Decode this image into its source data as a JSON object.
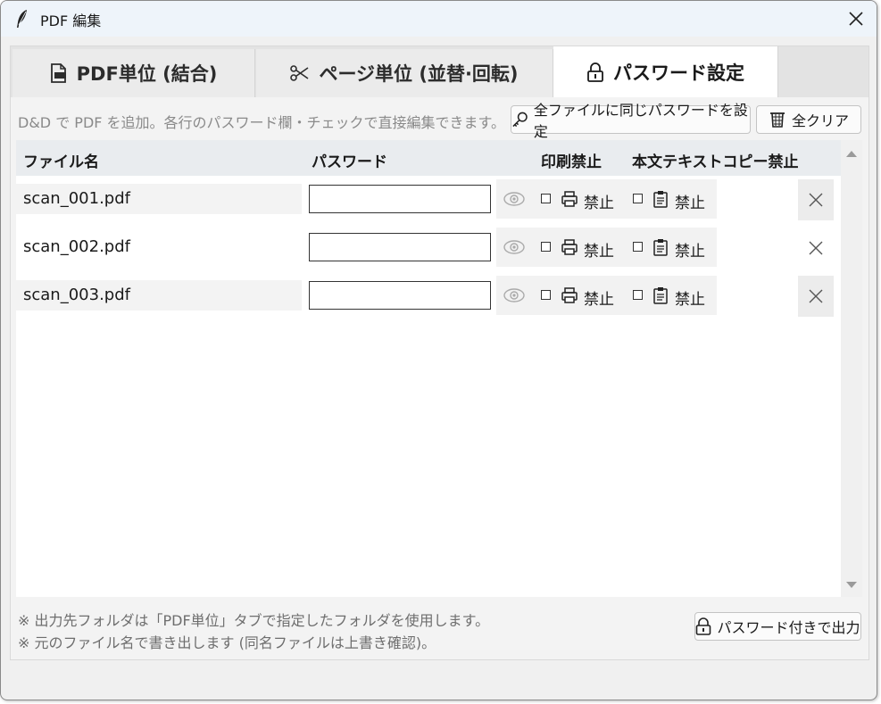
{
  "window": {
    "title": "PDF 編集"
  },
  "tabs": [
    {
      "label": "PDF単位 (結合)",
      "icon": "pdf-file-icon"
    },
    {
      "label": "ページ単位 (並替·回転)",
      "icon": "scissors-icon"
    },
    {
      "label": "パスワード設定",
      "icon": "lock-icon",
      "active": true
    }
  ],
  "toolbar": {
    "hint": "D&D で PDF を追加。各行のパスワード欄・チェックで直接編集できます。",
    "same_password_label": "全ファイルに同じパスワードを設定",
    "clear_all_label": "全クリア"
  },
  "table": {
    "headers": {
      "filename": "ファイル名",
      "password": "パスワード",
      "print_ban": "印刷禁止",
      "copy_ban": "本文テキストコピー禁止"
    },
    "rows": [
      {
        "filename": "scan_001.pdf",
        "password": "",
        "print_label": "禁止",
        "copy_label": "禁止",
        "print_checked": false,
        "copy_checked": false
      },
      {
        "filename": "scan_002.pdf",
        "password": "",
        "print_label": "禁止",
        "copy_label": "禁止",
        "print_checked": false,
        "copy_checked": false
      },
      {
        "filename": "scan_003.pdf",
        "password": "",
        "print_label": "禁止",
        "copy_label": "禁止",
        "print_checked": false,
        "copy_checked": false
      }
    ]
  },
  "footer": {
    "note1": "※ 出力先フォルダは「PDF単位」タブで指定したフォルダを使用します。",
    "note2": "※ 元のファイル名で書き出します (同名ファイルは上書き確認)。",
    "export_label": "パスワード付きで出力"
  },
  "colors": {
    "titlebar": "#eef4fa",
    "active_tab": "#ffffff",
    "header_row": "#e9ecef"
  }
}
